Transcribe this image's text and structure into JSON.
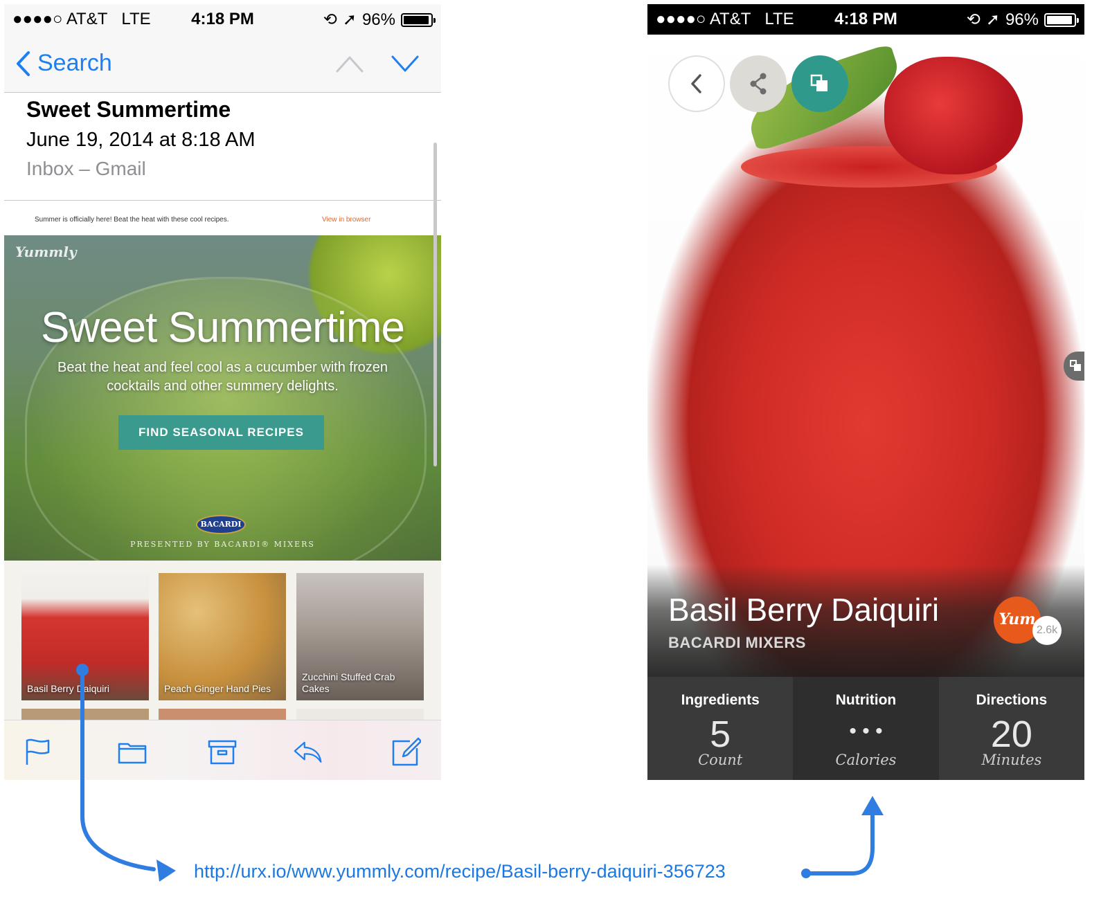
{
  "left_phone": {
    "status": {
      "signal_dots": "●●●●○",
      "carrier": "AT&T",
      "network": "LTE",
      "time": "4:18 PM",
      "battery": "96%"
    },
    "nav": {
      "back_label": "Search"
    },
    "message": {
      "subject": "Sweet Summertime",
      "date": "June 19, 2014 at 8:18 AM",
      "mailbox": "Inbox – Gmail"
    },
    "email": {
      "preheader": "Summer is officially here! Beat the heat with these cool recipes.",
      "view_in_browser": "View in browser",
      "brand": "Yummly",
      "hero_title": "Sweet Summertime",
      "hero_subtitle": "Beat the heat and feel cool as a cucumber with frozen cocktails and other summery delights.",
      "cta": "FIND SEASONAL RECIPES",
      "sponsor_logo": "BACARDI",
      "presented_by": "PRESENTED BY BACARDI® MIXERS",
      "recipes": [
        {
          "label": "Basil Berry Daiquiri"
        },
        {
          "label": "Peach Ginger Hand Pies"
        },
        {
          "label": "Zucchini Stuffed Crab Cakes"
        }
      ]
    },
    "toolbar": [
      "flag-icon",
      "folder-icon",
      "archive-icon",
      "reply-icon",
      "compose-icon"
    ]
  },
  "right_phone": {
    "status": {
      "signal_dots": "●●●●○",
      "carrier": "AT&T",
      "network": "LTE",
      "time": "4:18 PM",
      "battery": "96%"
    },
    "recipe": {
      "title": "Basil Berry Daiquiri",
      "source": "BACARDI MIXERS",
      "yum_label": "Yum",
      "yum_count": "2.6k"
    },
    "stats": [
      {
        "title": "Ingredients",
        "value": "5",
        "unit": "Count"
      },
      {
        "title": "Nutrition",
        "value": "• • •",
        "unit": "Calories"
      },
      {
        "title": "Directions",
        "value": "20",
        "unit": "Minutes"
      }
    ],
    "colors": {
      "accent": "#2f9a8b",
      "yum": "#e85a1c",
      "stats_bg": "#3a3a3a"
    }
  },
  "flow": {
    "url": "http://urx.io/www.yummly.com/recipe/Basil-berry-daiquiri-356723",
    "arrow_color": "#2f7de0"
  },
  "colors": {
    "ios_blue": "#1d7ff0",
    "cta_teal": "#3a9a8e",
    "view_link": "#e3662c"
  }
}
